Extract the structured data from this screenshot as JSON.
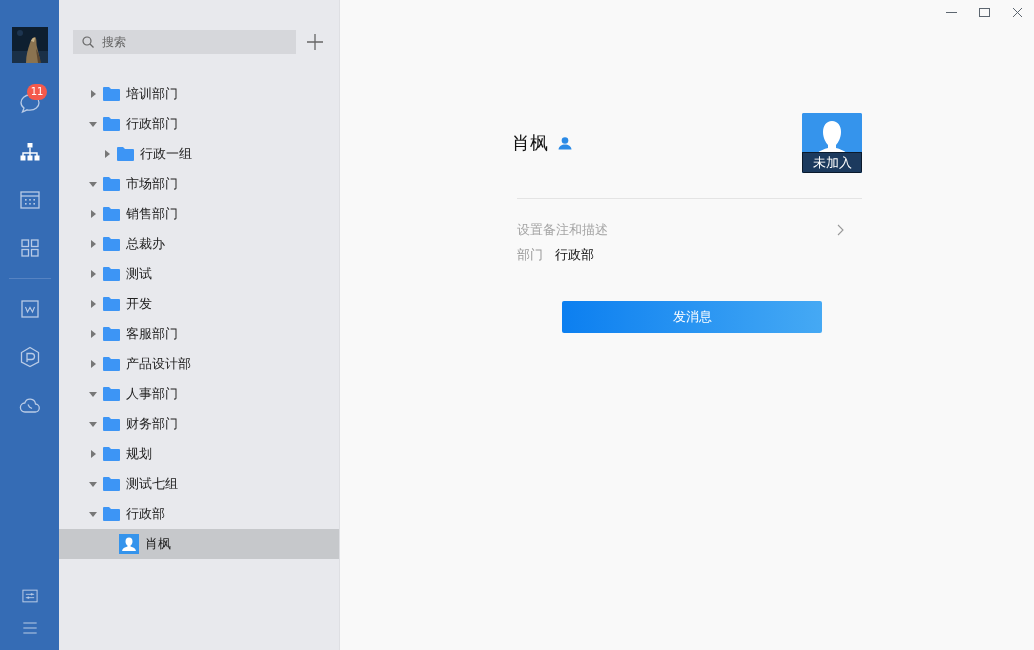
{
  "rail": {
    "top": [
      {
        "kind": "chat",
        "badge": "11",
        "selected": false
      },
      {
        "kind": "org",
        "selected": true
      },
      {
        "kind": "calendar",
        "selected": false
      },
      {
        "kind": "apps",
        "selected": false
      }
    ],
    "middle": [
      {
        "kind": "doc",
        "selected": false
      },
      {
        "kind": "hex",
        "selected": false
      },
      {
        "kind": "cloud",
        "selected": false
      }
    ],
    "bottom": [
      {
        "kind": "settings",
        "selected": false
      },
      {
        "kind": "menu",
        "selected": false
      }
    ]
  },
  "search": {
    "placeholder": "搜索"
  },
  "tree": [
    {
      "kind": "folder",
      "label": "培训部门",
      "expanded": false,
      "selected": false
    },
    {
      "kind": "folder",
      "label": "行政部门",
      "expanded": true,
      "selected": false,
      "children": [
        {
          "kind": "folder",
          "label": "行政一组",
          "expanded": false,
          "selected": false
        }
      ]
    },
    {
      "kind": "folder",
      "label": "市场部门",
      "expanded": true,
      "selected": false
    },
    {
      "kind": "folder",
      "label": "销售部门",
      "expanded": false,
      "selected": false
    },
    {
      "kind": "folder",
      "label": "总裁办",
      "expanded": false,
      "selected": false
    },
    {
      "kind": "folder",
      "label": "测试",
      "expanded": false,
      "selected": false
    },
    {
      "kind": "folder",
      "label": "开发",
      "expanded": false,
      "selected": false
    },
    {
      "kind": "folder",
      "label": "客服部门",
      "expanded": false,
      "selected": false
    },
    {
      "kind": "folder",
      "label": "产品设计部",
      "expanded": false,
      "selected": false
    },
    {
      "kind": "folder",
      "label": "人事部门",
      "expanded": true,
      "selected": false
    },
    {
      "kind": "folder",
      "label": "财务部门",
      "expanded": true,
      "selected": false
    },
    {
      "kind": "folder",
      "label": "规划",
      "expanded": false,
      "selected": false
    },
    {
      "kind": "folder",
      "label": "测试七组",
      "expanded": true,
      "selected": false
    },
    {
      "kind": "folder",
      "label": "行政部",
      "expanded": true,
      "selected": false,
      "children": [
        {
          "kind": "person",
          "label": "肖枫",
          "selected": true
        }
      ]
    }
  ],
  "profile": {
    "name": "肖枫",
    "avatar_badge": "未加入",
    "remark_link": "设置备注和描述",
    "fields": [
      {
        "label": "部门",
        "value": "行政部"
      }
    ],
    "send_button": "发消息"
  }
}
